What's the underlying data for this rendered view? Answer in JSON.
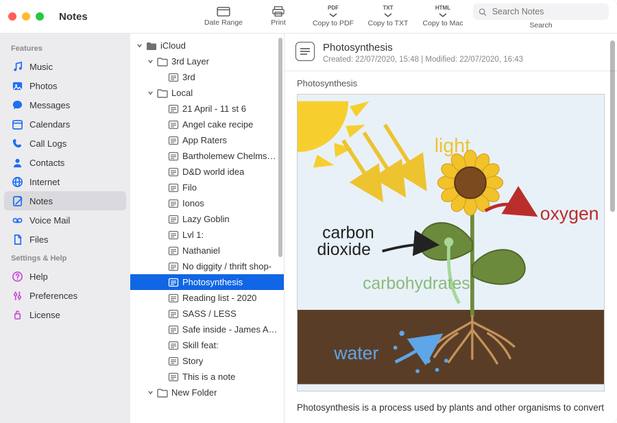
{
  "app": {
    "title": "Notes"
  },
  "toolbar": {
    "date_range": "Date Range",
    "print": "Print",
    "copy_pdf_top": "PDF",
    "copy_pdf": "Copy to PDF",
    "copy_txt_top": "TXT",
    "copy_txt": "Copy to TXT",
    "copy_html_top": "HTML",
    "copy_mac": "Copy to Mac",
    "search_placeholder": "Search Notes",
    "search_label": "Search"
  },
  "sidebar": {
    "features_header": "Features",
    "settings_header": "Settings & Help",
    "items": [
      {
        "label": "Music",
        "icon": "music",
        "color": "#1e6ff2"
      },
      {
        "label": "Photos",
        "icon": "photos",
        "color": "#1e6ff2"
      },
      {
        "label": "Messages",
        "icon": "messages",
        "color": "#1e6ff2"
      },
      {
        "label": "Calendars",
        "icon": "calendar",
        "color": "#1e6ff2"
      },
      {
        "label": "Call Logs",
        "icon": "phone",
        "color": "#1e6ff2"
      },
      {
        "label": "Contacts",
        "icon": "contacts",
        "color": "#1e6ff2"
      },
      {
        "label": "Internet",
        "icon": "globe",
        "color": "#1e6ff2"
      },
      {
        "label": "Notes",
        "icon": "notes",
        "color": "#1e6ff2",
        "active": true
      },
      {
        "label": "Voice Mail",
        "icon": "voicemail",
        "color": "#1e6ff2"
      },
      {
        "label": "Files",
        "icon": "files",
        "color": "#1e6ff2"
      }
    ],
    "settings": [
      {
        "label": "Help",
        "icon": "help",
        "color": "#c94cd6"
      },
      {
        "label": "Preferences",
        "icon": "prefs",
        "color": "#c94cd6"
      },
      {
        "label": "License",
        "icon": "license",
        "color": "#c94cd6"
      }
    ]
  },
  "tree": [
    {
      "depth": 0,
      "expanded": true,
      "kind": "folder-solid",
      "label": "iCloud"
    },
    {
      "depth": 1,
      "expanded": true,
      "kind": "folder",
      "label": "3rd Layer"
    },
    {
      "depth": 2,
      "kind": "note",
      "label": "3rd"
    },
    {
      "depth": 1,
      "expanded": true,
      "kind": "folder",
      "label": "Local"
    },
    {
      "depth": 2,
      "kind": "note",
      "label": "21 April - 11 st 6"
    },
    {
      "depth": 2,
      "kind": "note",
      "label": "Angel cake recipe"
    },
    {
      "depth": 2,
      "kind": "note",
      "label": "App Raters"
    },
    {
      "depth": 2,
      "kind": "note",
      "label": "Bartholemew Chelms…"
    },
    {
      "depth": 2,
      "kind": "note",
      "label": "D&D world idea"
    },
    {
      "depth": 2,
      "kind": "note",
      "label": "Filo"
    },
    {
      "depth": 2,
      "kind": "note",
      "label": "Ionos"
    },
    {
      "depth": 2,
      "kind": "note",
      "label": "Lazy Goblin"
    },
    {
      "depth": 2,
      "kind": "note",
      "label": "Lvl 1:"
    },
    {
      "depth": 2,
      "kind": "note",
      "label": "Nathaniel"
    },
    {
      "depth": 2,
      "kind": "note",
      "label": "No diggity / thrift shop-"
    },
    {
      "depth": 2,
      "kind": "note",
      "label": "Photosynthesis",
      "selected": true
    },
    {
      "depth": 2,
      "kind": "note",
      "label": "Reading list - 2020"
    },
    {
      "depth": 2,
      "kind": "note",
      "label": "SASS / LESS"
    },
    {
      "depth": 2,
      "kind": "note",
      "label": "Safe inside - James Ar…"
    },
    {
      "depth": 2,
      "kind": "note",
      "label": "Skill feat:"
    },
    {
      "depth": 2,
      "kind": "note",
      "label": "Story"
    },
    {
      "depth": 2,
      "kind": "note",
      "label": "This is a note"
    },
    {
      "depth": 1,
      "expanded": true,
      "kind": "folder",
      "label": "New Folder"
    }
  ],
  "note": {
    "title": "Photosynthesis",
    "meta": "Created: 22/07/2020, 15:48 | Modified: 22/07/2020, 16:43",
    "caption": "Photosynthesis",
    "body": "Photosynthesis is a process used by plants and other organisms to convert",
    "diagram": {
      "light": "light",
      "oxygen": "oxygen",
      "carbon": "carbon\ndioxide",
      "carbs": "carbohydrates",
      "water": "water"
    }
  }
}
